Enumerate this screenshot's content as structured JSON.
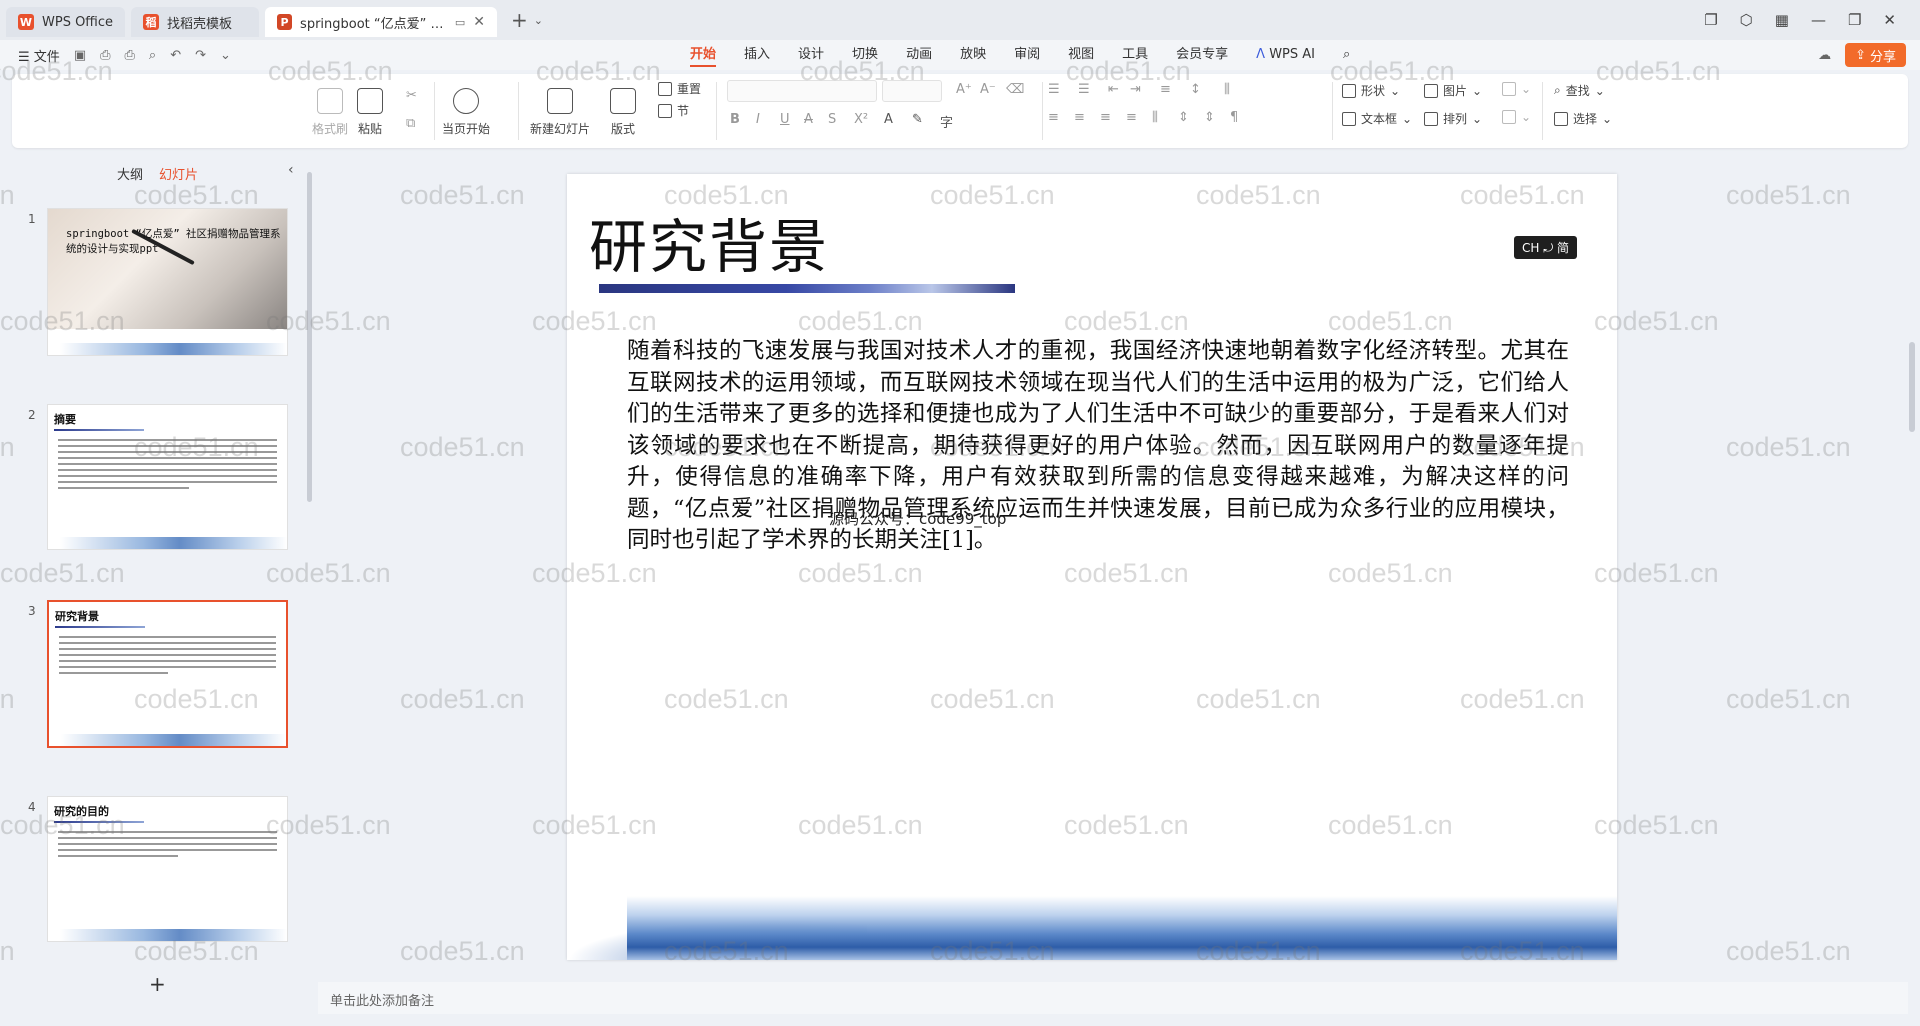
{
  "tabs": [
    {
      "label": "WPS Office",
      "logo": "W",
      "color": "#e8512d"
    },
    {
      "label": "找稻壳模板",
      "logo": "稻",
      "color": "#e8512d"
    },
    {
      "label": "springboot “亿点爱” 社区",
      "logo": "P",
      "color": "#d24726"
    }
  ],
  "menubar": {
    "file_label": "文件",
    "tabs": [
      "开始",
      "插入",
      "设计",
      "切换",
      "动画",
      "放映",
      "审阅",
      "视图",
      "工具",
      "会员专享"
    ],
    "ai_label": "WPS AI",
    "share_label": "分享"
  },
  "ribbon": {
    "format_painter": "格式刷",
    "paste": "粘贴",
    "play_current": "当页开始",
    "new_slide": "新建幻灯片",
    "layout": "版式",
    "reset": "重置",
    "section": "节",
    "shape": "形状",
    "picture": "图片",
    "textbox": "文本框",
    "arrange": "排列",
    "find": "查找",
    "select": "选择"
  },
  "left_panel": {
    "tab_outline": "大纲",
    "tab_slides": "幻灯片",
    "slides": [
      {
        "num": "1",
        "title": "springboot “亿点爱” 社区捐赠物品管理系统的设计与实现ppt"
      },
      {
        "num": "2",
        "title": "摘要"
      },
      {
        "num": "3",
        "title": "研究背景"
      },
      {
        "num": "4",
        "title": "研究的目的"
      }
    ],
    "add_slide": "+"
  },
  "slide": {
    "title": "研究背景",
    "body": "随着科技的飞速发展与我国对技术人才的重视，我国经济快速地朝着数字化经济转型。尤其在互联网技术的运用领域，而互联网技术领域在现当代人们的生活中运用的极为广泛，它们给人们的生活带来了更多的选择和便捷也成为了人们生活中不可缺少的重要部分，于是看来人们对该领域的要求也在不断提高，期待获得更好的用户体验。然而，因互联网用户的数量逐年提升，使得信息的准确率下降，用户有效获取到所需的信息变得越来越难，为解决这样的问题，“亿点爱”社区捐赠物品管理系统应运而生并快速发展，目前已成为众多行业的应用模块，同时也引起了学术界的长期关注[1]。",
    "overlay": "源码公众号：code99_top"
  },
  "watermark": "code51.cn",
  "ime_badge": "CH ⤾ 简",
  "notes_placeholder": "单击此处添加备注"
}
